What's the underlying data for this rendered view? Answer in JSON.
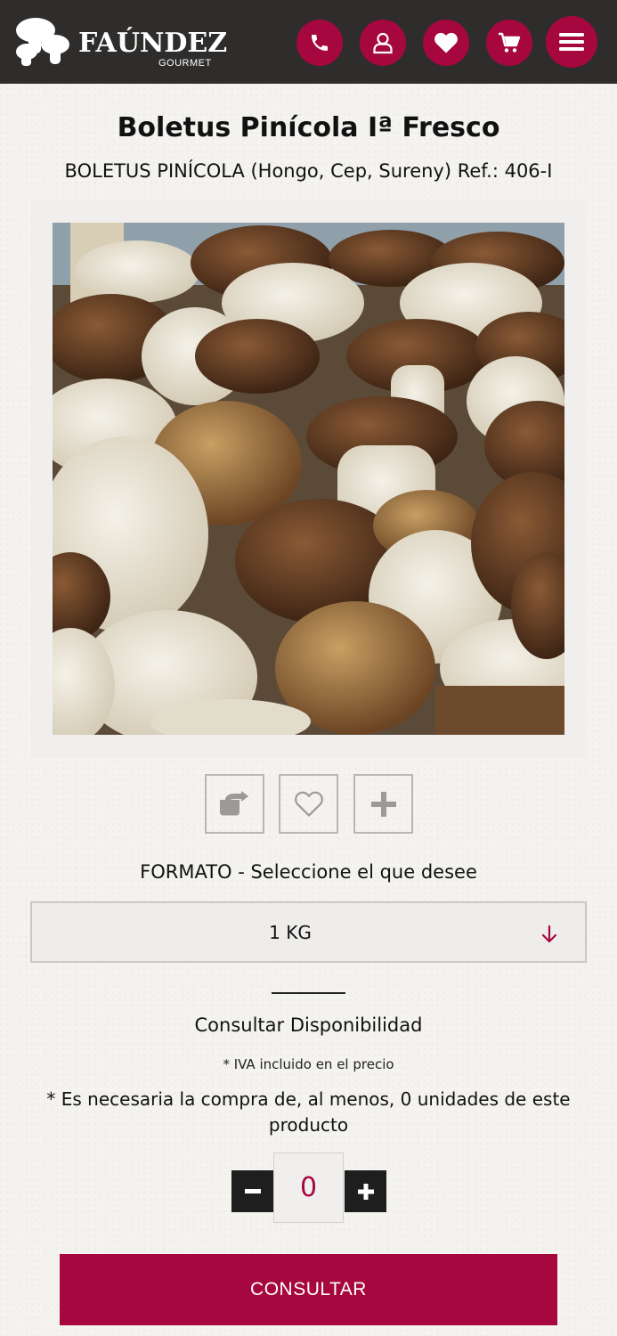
{
  "header": {
    "brand_name": "FAÚNDEZ",
    "brand_sub": "GOURMET",
    "icons": [
      "phone-icon",
      "user-icon",
      "heart-icon",
      "cart-icon",
      "menu-icon"
    ],
    "accent_color": "#a6073e",
    "bar_color": "#2e2d2c"
  },
  "product": {
    "title": "Boletus Pinícola Iª Fresco",
    "subtitle": "BOLETUS PINÍCOLA (Hongo, Cep, Sureny) Ref.: 406-I",
    "image_alt": "Boletus Pinícola Iª Fresco"
  },
  "actions": {
    "icons": [
      "share-icon",
      "heart-outline-icon",
      "plus-icon"
    ]
  },
  "format": {
    "label": "FORMATO - Seleccione el que desee",
    "selected": "1 KG"
  },
  "availability": "Consultar Disponibilidad",
  "iva_note": "* IVA incluido en el precio",
  "min_note": "* Es necesaria la compra de, al menos, 0 unidades de este producto",
  "quantity": {
    "value": "0",
    "minus": "−",
    "plus": "+"
  },
  "consult_button": "CONSULTAR"
}
